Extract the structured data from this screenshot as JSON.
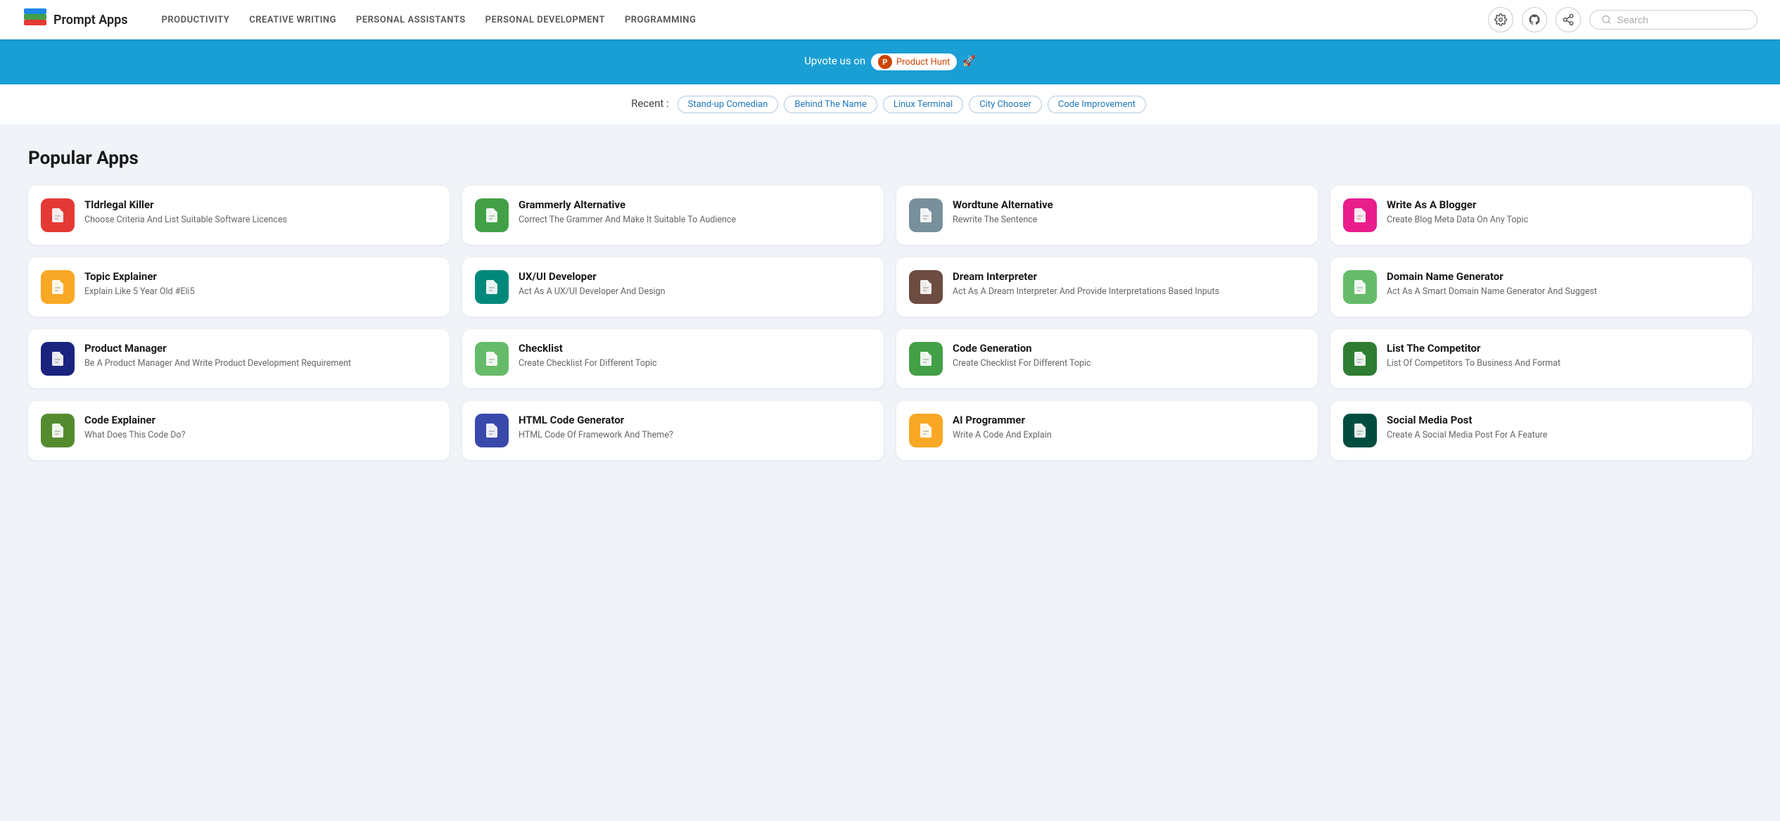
{
  "nav": {
    "logo_text": "Prompt Apps",
    "links": [
      "PRODUCTIVITY",
      "CREATIVE WRITING",
      "PERSONAL ASSISTANTS",
      "PERSONAL DEVELOPMENT",
      "PROGRAMMING"
    ],
    "search_placeholder": "Search"
  },
  "banner": {
    "text_before": "Upvote us on",
    "ph_label": "Product Hunt",
    "emoji": "🚀"
  },
  "recent": {
    "label": "Recent :",
    "tags": [
      "Stand-up Comedian",
      "Behind The Name",
      "Linux Terminal",
      "City Chooser",
      "Code Improvement"
    ]
  },
  "popular": {
    "title": "Popular Apps",
    "apps": [
      {
        "name": "Tldrlegal Killer",
        "desc": "Choose Criteria And List Suitable Software Licences",
        "icon_color": "icon-red",
        "icon": "doc"
      },
      {
        "name": "Grammerly Alternative",
        "desc": "Correct The Grammer And Make It Suitable To Audience",
        "icon_color": "icon-green",
        "icon": "doc"
      },
      {
        "name": "Wordtune Alternative",
        "desc": "Rewrite The Sentence",
        "icon_color": "icon-gray",
        "icon": "doc"
      },
      {
        "name": "Write As A Blogger",
        "desc": "Create Blog Meta Data On Any Topic",
        "icon_color": "icon-pink",
        "icon": "doc"
      },
      {
        "name": "Topic Explainer",
        "desc": "Explain Like 5 Year Old #Eli5",
        "icon_color": "icon-yellow",
        "icon": "doc"
      },
      {
        "name": "UX/UI Developer",
        "desc": "Act As A UX/UI Developer And Design",
        "icon_color": "icon-teal",
        "icon": "doc"
      },
      {
        "name": "Dream Interpreter",
        "desc": "Act As A Dream Interpreter And Provide Interpretations Based Inputs",
        "icon_color": "icon-brown",
        "icon": "doc"
      },
      {
        "name": "Domain Name Generator",
        "desc": "Act As A Smart Domain Name Generator And Suggest",
        "icon_color": "icon-light-green",
        "icon": "doc"
      },
      {
        "name": "Product Manager",
        "desc": "Be A Product Manager And Write Product Development Requirement",
        "icon_color": "icon-dark-blue",
        "icon": "doc"
      },
      {
        "name": "Checklist",
        "desc": "Create Checklist For Different Topic",
        "icon_color": "icon-light-green",
        "icon": "doc"
      },
      {
        "name": "Code Generation",
        "desc": "Create Checklist For Different Topic",
        "icon_color": "icon-green",
        "icon": "doc"
      },
      {
        "name": "List The Competitor",
        "desc": "List Of Competitors To Business And Format",
        "icon_color": "icon-dark-green",
        "icon": "doc"
      },
      {
        "name": "Code Explainer",
        "desc": "What Does This Code Do?",
        "icon_color": "icon-olive",
        "icon": "doc"
      },
      {
        "name": "HTML Code Generator",
        "desc": "HTML Code Of Framework And Theme?",
        "icon_color": "icon-indigo",
        "icon": "doc"
      },
      {
        "name": "AI Programmer",
        "desc": "Write A Code And Explain",
        "icon_color": "icon-gold",
        "icon": "doc"
      },
      {
        "name": "Social Media Post",
        "desc": "Create A Social Media Post For A Feature",
        "icon_color": "icon-dark-teal",
        "icon": "doc"
      }
    ]
  }
}
